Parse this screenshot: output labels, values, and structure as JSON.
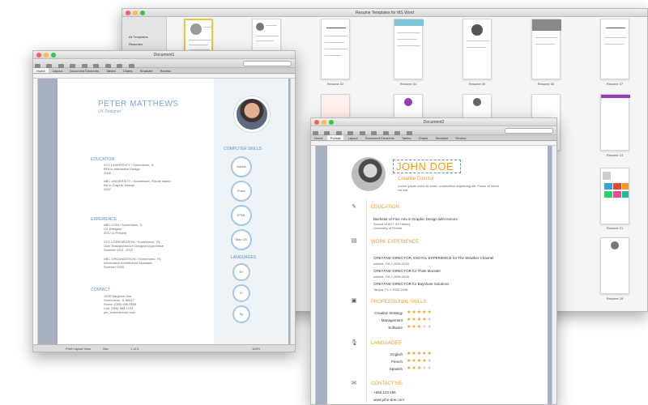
{
  "browser_window": {
    "title": "Resume Templates for MS Word",
    "sidebar": [
      "All Templates",
      "Resumes",
      "Template Mix"
    ],
    "labels": [
      "Resume 02",
      "Resume 04",
      "Resume 05",
      "Resume 06",
      "Resume 07",
      "Resume 14",
      "Resume 21",
      "Resume 28"
    ]
  },
  "doc1": {
    "title": "Document1",
    "ribbon": [
      "Home",
      "Layout",
      "Document Elements",
      "Tables",
      "Charts",
      "SmartArt",
      "Review"
    ],
    "name": "PETER MATTHEWS",
    "role": "UX Designer",
    "education_heading": "EDUCATION",
    "education": [
      [
        "XYZ UNIVERSITY / Somertown, IL",
        "BFA in Interactive Design",
        "2008"
      ],
      [
        "ABC UNIVERSITY / Somertown, Rhode Island",
        "BA in Graphic Design",
        "2007"
      ]
    ],
    "experience_heading": "EXPERIENCE",
    "experience": [
      [
        "ABC.COM / Somertown, IL",
        "UX Designer",
        "2012 to Present"
      ],
      [
        "XYZ CORPORATION / Somertown, TN",
        "User Researcher/UX Designer Apprentice",
        "Summer 2011, 2010"
      ],
      [
        "ABC ORGANIZATION / Somertown, TN",
        "Information Architecture Assistant",
        "Summer 2009"
      ]
    ],
    "contact_heading": "CONTACT",
    "contact": [
      "1025 Hargrove Ave",
      "Somertown, IL 60647",
      "Home: (000) 555-5555",
      "Cell: (555) 555-1234",
      "pm_somedomain.com"
    ],
    "skills_heading": "COMPUTER SKILLS",
    "skills": [
      "Adobe",
      "Flash",
      "HTML",
      "Mac OS"
    ],
    "languages_heading": "LANGUAGES",
    "languages": [
      "En",
      "Fr",
      "Sp"
    ],
    "status_view": "Print Layout View",
    "status_sec": "Sec",
    "status_page": "1 of 3",
    "status_zoom": "100%"
  },
  "doc2": {
    "title": "Document2",
    "ribbon": [
      "Home",
      "Format",
      "Layout",
      "Document Elements",
      "Tables",
      "Charts",
      "SmartArt",
      "Review"
    ],
    "name": "JOHN DOE",
    "role": "Creative Director",
    "summary": "Lorem ipsum dolor sit amet, consectetur adipiscing elit. Fusce et lorem vel nisi.",
    "education_heading": "EDUCATION",
    "education": [
      "Bachelor of Fine Arts in Graphic Design with Honors",
      "School of Art + Art History",
      "University of Florida"
    ],
    "work_heading": "WORK EXPERIENCE",
    "work": [
      [
        "CREATIVE DIRECTOR, DIGITAL EXPERIENCE for The Weather Channel",
        "Atlanta, GA // 2008-2016"
      ],
      [
        "CREATIVE DIRECTOR for Think Monster",
        "Atlanta, GA // 2006-2008"
      ],
      [
        "CREATIVE DIRECTOR for Bayshore Solutions",
        "Tampa, FL // 2002-2006"
      ]
    ],
    "skills_heading": "PROFESSIONAL SKILLS",
    "skills": [
      {
        "name": "Creative Strategy",
        "stars": 5
      },
      {
        "name": "Management",
        "stars": 4
      },
      {
        "name": "Software",
        "stars": 3
      }
    ],
    "languages_heading": "LANGUAGES",
    "languages": [
      {
        "name": "English",
        "stars": 5
      },
      {
        "name": "French",
        "stars": 4
      },
      {
        "name": "Spanish",
        "stars": 3
      }
    ],
    "contact_heading": "CONTACT ME",
    "contact": [
      "+555 123 456",
      "www.john-doe.com"
    ]
  }
}
